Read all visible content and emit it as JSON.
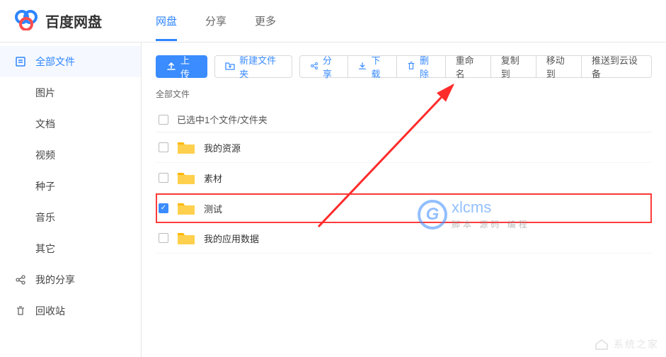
{
  "header": {
    "app_name": "百度网盘",
    "tabs": [
      {
        "label": "网盘",
        "active": true
      },
      {
        "label": "分享",
        "active": false
      },
      {
        "label": "更多",
        "active": false
      }
    ]
  },
  "sidebar": {
    "items": [
      {
        "label": "全部文件",
        "icon": "files-icon",
        "active": true,
        "sub": false
      },
      {
        "label": "图片",
        "icon": "",
        "active": false,
        "sub": true
      },
      {
        "label": "文档",
        "icon": "",
        "active": false,
        "sub": true
      },
      {
        "label": "视频",
        "icon": "",
        "active": false,
        "sub": true
      },
      {
        "label": "种子",
        "icon": "",
        "active": false,
        "sub": true
      },
      {
        "label": "音乐",
        "icon": "",
        "active": false,
        "sub": true
      },
      {
        "label": "其它",
        "icon": "",
        "active": false,
        "sub": true
      },
      {
        "label": "我的分享",
        "icon": "share-icon",
        "active": false,
        "sub": false
      },
      {
        "label": "回收站",
        "icon": "trash-icon",
        "active": false,
        "sub": false
      }
    ]
  },
  "toolbar": {
    "upload_label": "上传",
    "new_folder_label": "新建文件夹",
    "share_label": "分享",
    "download_label": "下载",
    "delete_label": "删除",
    "rename_label": "重命名",
    "copy_to_label": "复制到",
    "move_to_label": "移动到",
    "push_label": "推送到云设备"
  },
  "breadcrumb": "全部文件",
  "selection_status": "已选中1个文件/文件夹",
  "files": [
    {
      "name": "我的资源",
      "checked": false,
      "highlighted": false
    },
    {
      "name": "素材",
      "checked": false,
      "highlighted": false
    },
    {
      "name": "测试",
      "checked": true,
      "highlighted": true
    },
    {
      "name": "我的应用数据",
      "checked": false,
      "highlighted": false
    }
  ],
  "watermark": {
    "brand": "xlcms",
    "sub": "脚本 源码 编程"
  },
  "footer_watermark": "系统之家"
}
